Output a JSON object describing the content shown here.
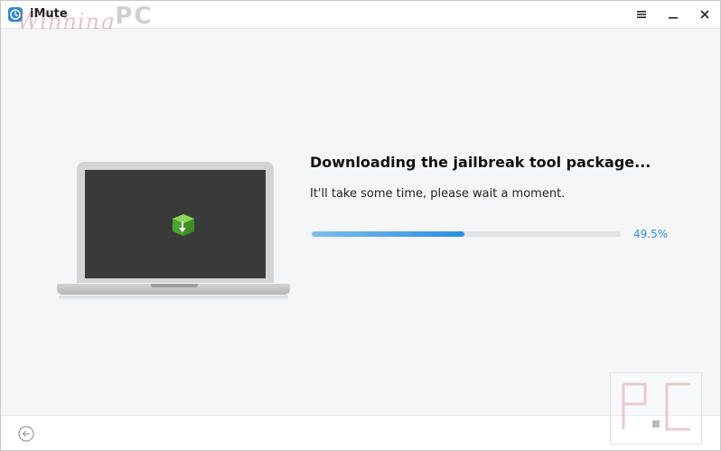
{
  "titlebar": {
    "app_name": "iMute",
    "watermark_script": "Winning",
    "watermark_letters": "PC",
    "icons": [
      "menu-icon",
      "minimize-icon",
      "close-icon"
    ]
  },
  "main": {
    "heading": "Downloading the jailbreak tool package...",
    "subtext": "It'll take some time, please wait a moment.",
    "progress_percent_text": "49.5%",
    "progress_fraction": 0.495
  },
  "footer": {
    "icons": [
      "back-arrow-icon"
    ]
  },
  "colors": {
    "accent": "#2a8ee3",
    "progress_track": "#e1e3e6",
    "screen": "#3a3a3a",
    "package_green": "#5cb531"
  }
}
